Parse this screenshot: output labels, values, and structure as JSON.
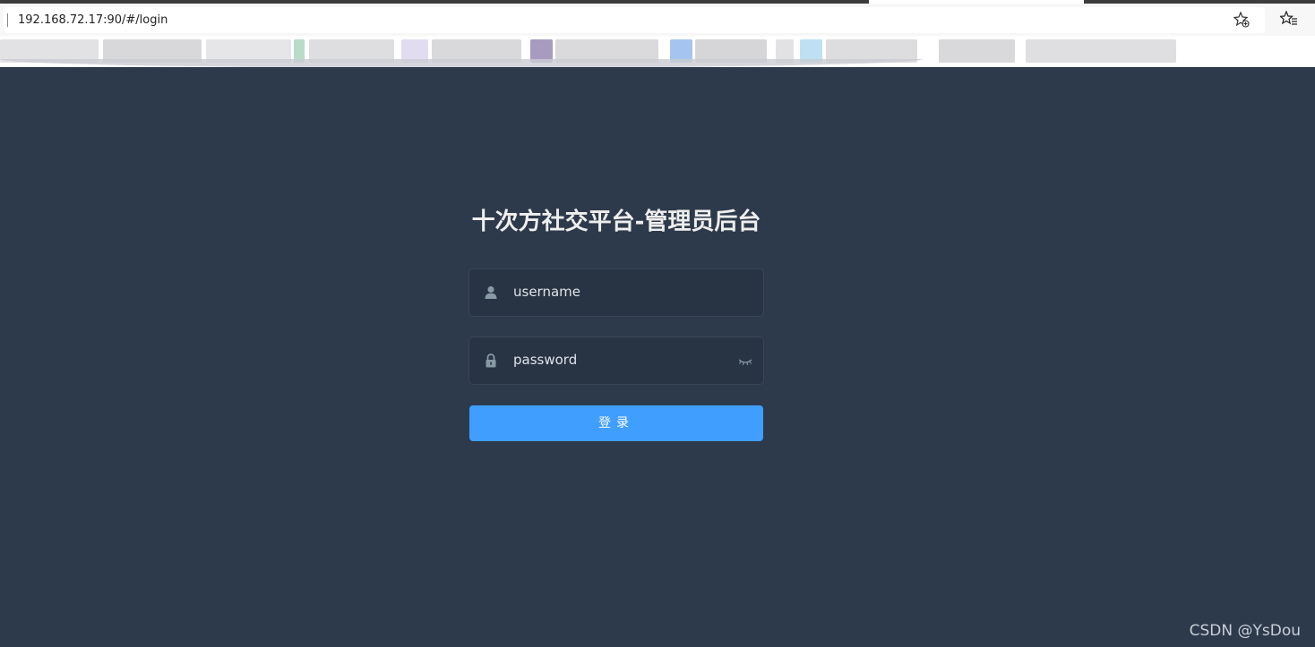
{
  "browser": {
    "url": "192.168.72.17:90/#/login",
    "favorite_icon": "star-plus-icon",
    "collections_icon": "star-list-icon"
  },
  "login": {
    "title": "十次方社交平台-管理员后台",
    "username_value": "username",
    "password_value": "password",
    "submit_label": "登录",
    "user_icon": "user-icon",
    "lock_icon": "lock-icon",
    "eye_icon": "eye-closed-icon"
  },
  "watermark": "CSDN @YsDou",
  "colors": {
    "background": "#2d3a4b",
    "input_background": "#283443",
    "button": "#409eff",
    "title": "#eeeeee"
  }
}
